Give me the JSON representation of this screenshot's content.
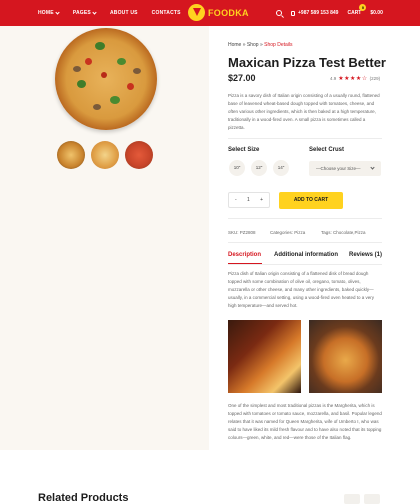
{
  "nav": {
    "items": [
      {
        "label": "HOME",
        "dropdown": true
      },
      {
        "label": "PAGES",
        "dropdown": true
      },
      {
        "label": "ABOUT US",
        "dropdown": false
      },
      {
        "label": "CONTACTS",
        "dropdown": false
      }
    ],
    "logo": "FOODKA",
    "phone": "+987 589 153 849",
    "cart_label": "CART",
    "cart_count": "0",
    "cart_total": "$0.00"
  },
  "breadcrumb": {
    "home": "Home",
    "sep": "»",
    "shop": "Shop",
    "current": "Shop Details"
  },
  "product": {
    "title": "Maxican Pizza Test Better",
    "price": "$27.00",
    "rating_value": "4.9",
    "stars": "★★★★☆",
    "reviews": "(229)",
    "description": "Pizza is a savory dish of Italian origin consisting of a usually round, flattened base of leavened wheat-based dough topped with tomatoes, cheese, and often various other ingredients, which is then baked at a high temperature, traditionally in a wood-fired oven. A small pizza is sometimes called a pizzetta."
  },
  "options": {
    "size_label": "Select Size",
    "sizes": [
      "10\"",
      "12\"",
      "14\""
    ],
    "crust_label": "Select Crust",
    "crust_placeholder": "—Choose your Size—"
  },
  "cart": {
    "minus": "-",
    "qty": "1",
    "plus": "+",
    "add_label": "ADD TO CART"
  },
  "meta": {
    "sku": "SKU: PZ2808",
    "categories": "Categories: Pizza",
    "tags": "Tags: Chocolate,Pizza"
  },
  "tabs": [
    {
      "label": "Description",
      "active": true
    },
    {
      "label": "Additional information",
      "active": false
    },
    {
      "label": "Reviews (1)",
      "active": false
    }
  ],
  "tab_content": {
    "paragraph1": "Pizza dish of Italian origin consisting of a flattened disk of bread dough topped with some combination of olive oil, oregano, tomato, olives, mozzarella or other cheese, and many other ingredients, baked quickly—usually, in a commercial setting, using a wood-fired oven heated to a very high temperature—and served hot.",
    "paragraph2": "One of the simplest and most traditional pizzas is the Margherita, which is topped with tomatoes or tomato sauce, mozzarella, and basil. Popular legend relates that it was named for Queen Margherita, wife of Umberto I, who was said to have liked its mild fresh flavour and to have also noted that its topping colours—green, white, and red—were those of the Italian flag."
  },
  "related": {
    "title": "Related Products"
  },
  "colors": {
    "brand_red": "#d5161f",
    "accent_yellow": "#ffd21f",
    "panel_bg": "#faf7f2"
  }
}
